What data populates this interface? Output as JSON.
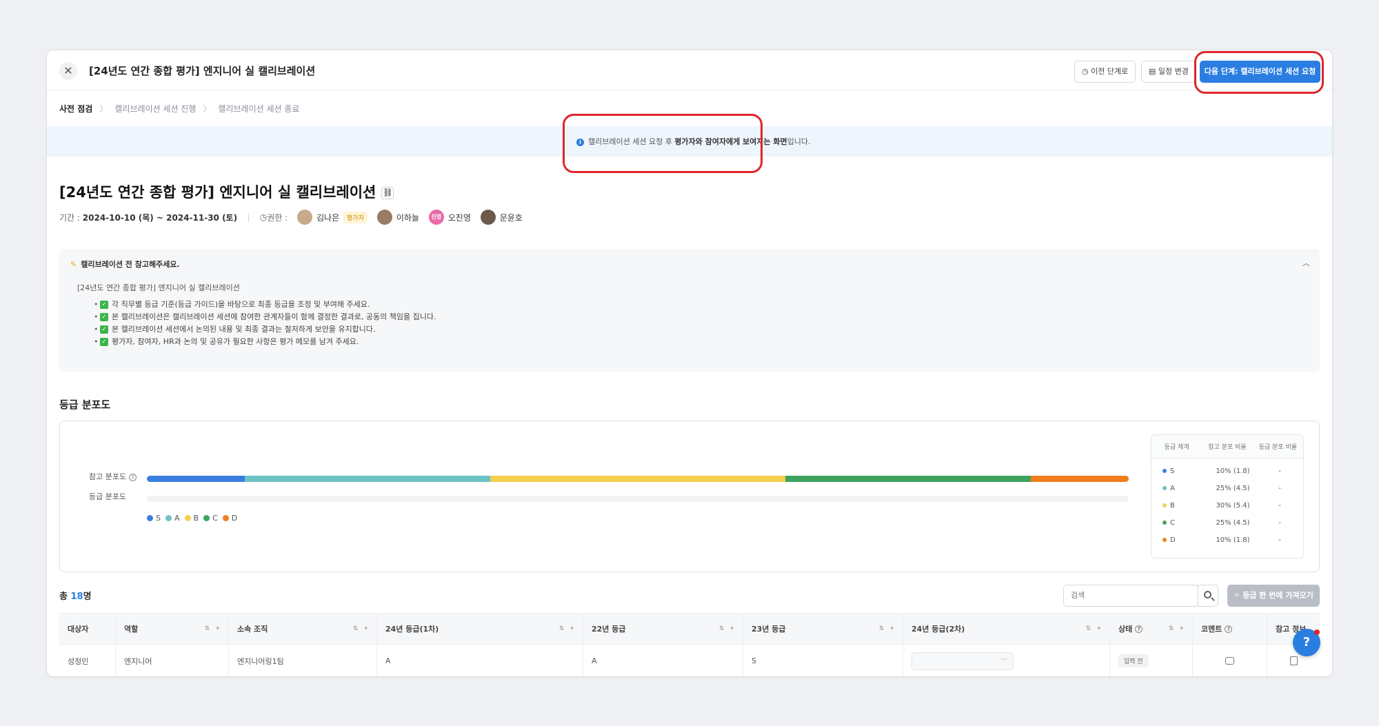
{
  "header": {
    "title": "[24년도 연간 종합 평가] 엔지니어 실 캘리브레이션",
    "prev_label": "이전 단계로",
    "schedule_label": "일정 변경",
    "next_label": "다음 단계: 캘리브레이션 세션 요청"
  },
  "steps": [
    "사전 점검",
    "캘리브레이션 세션 진행",
    "캘리브레이션 세션 종료"
  ],
  "banner": {
    "pre": "캘리브레이션 세션 요청 후 ",
    "bold": "평가자와 참여자에게 보여지는 화면",
    "post": "입니다."
  },
  "page": {
    "title": "[24년도 연간 종합 평가] 엔지니어 실 캘리브레이션",
    "period_label": "기간 :",
    "period": "2024-10-10 (목) ~ 2024-11-30 (토)",
    "auth_label": "권한 :",
    "people": [
      {
        "name": "김나은",
        "badge": "평가자"
      },
      {
        "name": "이하늘"
      },
      {
        "name": "오진영",
        "avatar_text": "진영"
      },
      {
        "name": "문윤호"
      }
    ]
  },
  "notice": {
    "heading": "캘리브레이션 전 참고해주세요.",
    "subtitle": "[24년도 연간 종합 평가] 엔지니어 실 캘리브레이션",
    "items": [
      "각 직무별 등급 기준(등급 가이드)을 바탕으로 최종 등급을 조정 및 부여해 주세요.",
      "본 캘리브레이션은 캘리브레이션 세션에 참여한 관계자들이 함께 결정한 결과로, 공동의 책임을 집니다.",
      "본 캘리브레이션 세션에서 논의된 내용 및 최종 결과는 철저하게 보안을 유지합니다.",
      "평가자, 참여자, HR과 논의 및 공유가 필요한 사항은 평가 메모를 남겨 주세요."
    ]
  },
  "distribution": {
    "title": "등급 분포도",
    "row1_label": "참고 분포도",
    "row2_label": "등급 분포도",
    "table_headers": [
      "등급 체계",
      "참고 분포 비율",
      "등급 분포 비율"
    ]
  },
  "chart_data": {
    "type": "bar",
    "categories": [
      "S",
      "A",
      "B",
      "C",
      "D"
    ],
    "series": [
      {
        "name": "참고 분포도",
        "values": [
          10,
          25,
          30,
          25,
          10
        ]
      }
    ],
    "reference_counts": [
      1.8,
      4.5,
      5.4,
      4.5,
      1.8
    ],
    "reference_labels": [
      "10% (1.8)",
      "25% (4.5)",
      "30% (5.4)",
      "25% (4.5)",
      "10% (1.8)"
    ],
    "grade_ratio_labels": [
      "-",
      "-",
      "-",
      "-",
      "-"
    ],
    "colors": [
      "#3b7fe0",
      "#6cc3c6",
      "#f5cf4f",
      "#3ea35f",
      "#f07d1e"
    ]
  },
  "list": {
    "total_prefix": "총 ",
    "total_count": "18",
    "total_suffix": "명",
    "search_placeholder": "검색",
    "bulk_label": "등급 한 번에 가져오기",
    "columns": [
      "대상자",
      "역할",
      "소속 조직",
      "24년 등급(1차)",
      "22년 등급",
      "23년 등급",
      "24년 등급(2차)",
      "상태",
      "코멘트",
      "참고 정보"
    ],
    "rows": [
      {
        "name": "성정민",
        "role": "엔지니어",
        "org": "엔지니어링1팀",
        "g24_1": "A",
        "g22": "A",
        "g23": "S",
        "status": "입력 전"
      }
    ]
  },
  "colors": {
    "accent": "#2a7de1",
    "highlight": "#e0242b"
  }
}
